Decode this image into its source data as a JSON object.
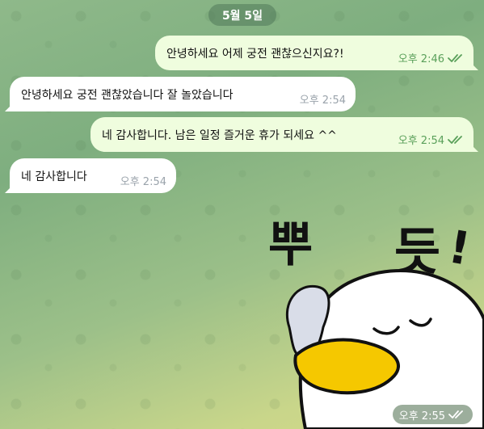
{
  "date_label": "5월 5일",
  "messages": [
    {
      "direction": "out",
      "text": "안녕하세요 어제 궁전 괜찮으신지요?!",
      "time": "오후 2:46",
      "status": "read"
    },
    {
      "direction": "in",
      "text": "안녕하세요 궁전 괜찮았습니다 잘 놀았습니다",
      "time": "오후 2:54"
    },
    {
      "direction": "out",
      "text": "네 감사합니다. 남은 일정 즐거운 휴가 되세요  ^^",
      "time": "오후 2:54",
      "status": "read"
    },
    {
      "direction": "in",
      "text": "네 감사합니다",
      "time": "오후 2:54"
    }
  ],
  "sticker": {
    "text": "뿌 듯!",
    "time": "오후 2:55",
    "status": "read"
  },
  "colors": {
    "outgoing_bubble": "#effdde",
    "incoming_bubble": "#ffffff",
    "read_check": "#5aa05a",
    "duck_beak": "#f5c800"
  }
}
